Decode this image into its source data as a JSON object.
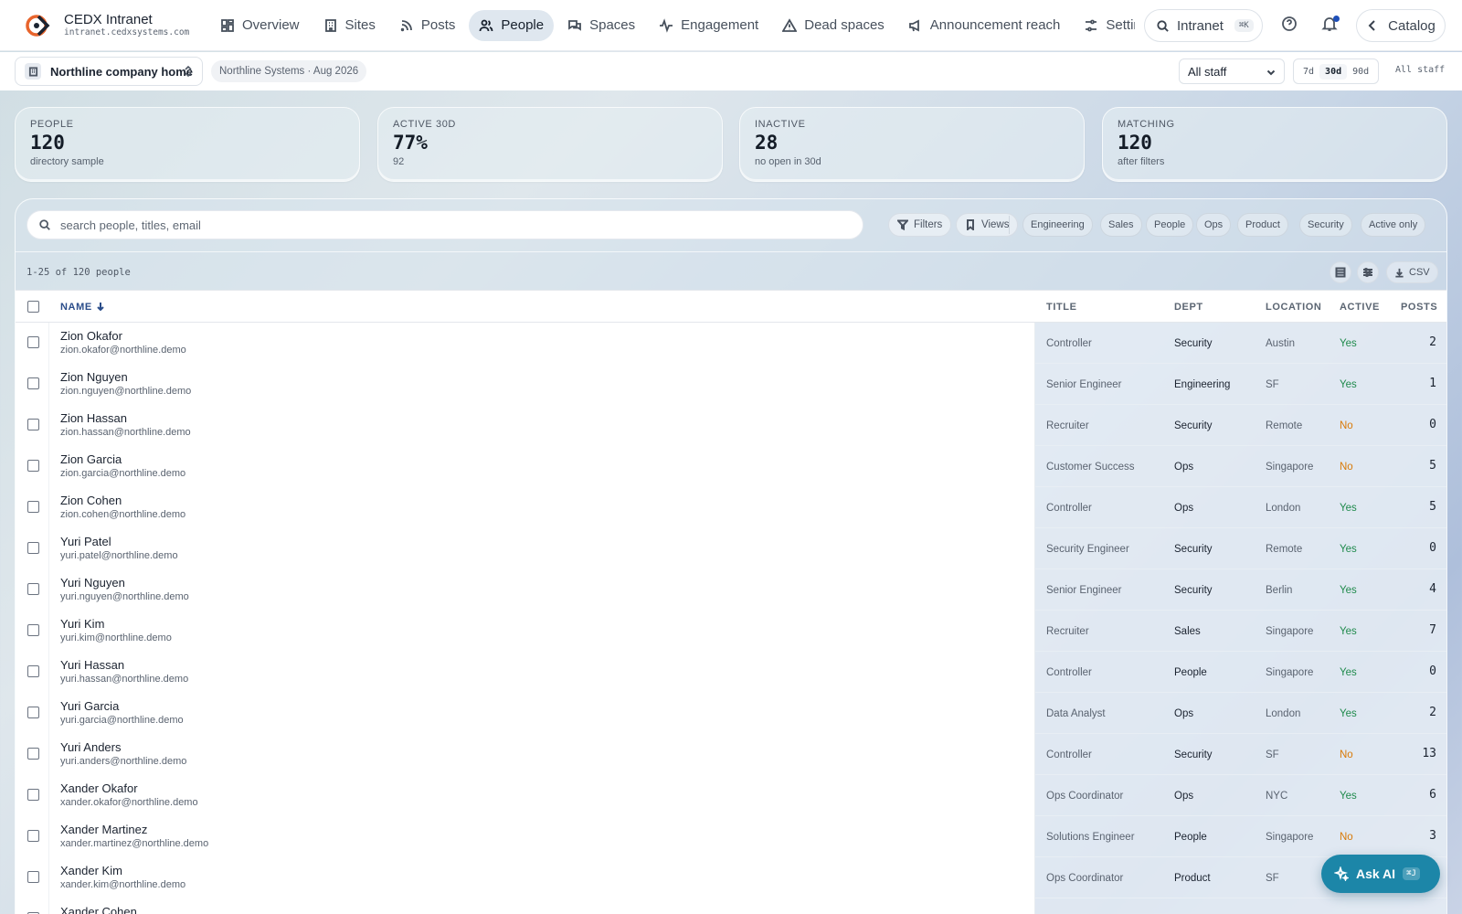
{
  "brand": {
    "name": "CEDX Intranet",
    "url": "intranet.cedxsystems.com"
  },
  "nav": [
    {
      "label": "Overview",
      "icon": "layout-grid-icon",
      "active": false
    },
    {
      "label": "Sites",
      "icon": "building-icon",
      "active": false
    },
    {
      "label": "Posts",
      "icon": "rss-icon",
      "active": false
    },
    {
      "label": "People",
      "icon": "users-icon",
      "active": true
    },
    {
      "label": "Spaces",
      "icon": "messages-icon",
      "active": false
    },
    {
      "label": "Engagement",
      "icon": "activity-icon",
      "active": false
    },
    {
      "label": "Dead spaces",
      "icon": "warning-triangle-icon",
      "active": false
    },
    {
      "label": "Announcement reach",
      "icon": "megaphone-icon",
      "active": false
    },
    {
      "label": "Settings",
      "icon": "sliders-icon",
      "active": false
    }
  ],
  "search": {
    "label": "Intranet",
    "shortcut": "⌘K"
  },
  "catalog_label": "Catalog",
  "subbar": {
    "site": "Northline company home",
    "org": "Northline Systems · Aug 2026",
    "staff_filter": "All staff",
    "ranges": [
      "7d",
      "30d",
      "90d"
    ],
    "active_range": "30d",
    "scope_label": "All staff"
  },
  "stats": [
    {
      "label": "PEOPLE",
      "value": "120",
      "sub": "directory sample"
    },
    {
      "label": "ACTIVE 30D",
      "value": "77%",
      "sub": "92"
    },
    {
      "label": "INACTIVE",
      "value": "28",
      "sub": "no open in 30d"
    },
    {
      "label": "MATCHING",
      "value": "120",
      "sub": "after filters"
    }
  ],
  "table_search_placeholder": "search people, titles, email",
  "filters_label": "Filters",
  "views_label": "Views",
  "chips": [
    "Engineering",
    "Sales",
    "People",
    "Ops",
    "Product",
    "Security",
    "Active only"
  ],
  "count_text": "1-25 of 120 people",
  "csv_label": "CSV",
  "columns": {
    "name": "NAME",
    "title": "TITLE",
    "dept": "DEPT",
    "location": "LOCATION",
    "active": "ACTIVE",
    "posts": "POSTS"
  },
  "rows": [
    {
      "name": "Zion Okafor",
      "email": "zion.okafor@northline.demo",
      "title": "Controller",
      "dept": "Security",
      "location": "Austin",
      "active": "Yes",
      "posts": "2"
    },
    {
      "name": "Zion Nguyen",
      "email": "zion.nguyen@northline.demo",
      "title": "Senior Engineer",
      "dept": "Engineering",
      "location": "SF",
      "active": "Yes",
      "posts": "1"
    },
    {
      "name": "Zion Hassan",
      "email": "zion.hassan@northline.demo",
      "title": "Recruiter",
      "dept": "Security",
      "location": "Remote",
      "active": "No",
      "posts": "0"
    },
    {
      "name": "Zion Garcia",
      "email": "zion.garcia@northline.demo",
      "title": "Customer Success",
      "dept": "Ops",
      "location": "Singapore",
      "active": "No",
      "posts": "5"
    },
    {
      "name": "Zion Cohen",
      "email": "zion.cohen@northline.demo",
      "title": "Controller",
      "dept": "Ops",
      "location": "London",
      "active": "Yes",
      "posts": "5"
    },
    {
      "name": "Yuri Patel",
      "email": "yuri.patel@northline.demo",
      "title": "Security Engineer",
      "dept": "Security",
      "location": "Remote",
      "active": "Yes",
      "posts": "0"
    },
    {
      "name": "Yuri Nguyen",
      "email": "yuri.nguyen@northline.demo",
      "title": "Senior Engineer",
      "dept": "Security",
      "location": "Berlin",
      "active": "Yes",
      "posts": "4"
    },
    {
      "name": "Yuri Kim",
      "email": "yuri.kim@northline.demo",
      "title": "Recruiter",
      "dept": "Sales",
      "location": "Singapore",
      "active": "Yes",
      "posts": "7"
    },
    {
      "name": "Yuri Hassan",
      "email": "yuri.hassan@northline.demo",
      "title": "Controller",
      "dept": "People",
      "location": "Singapore",
      "active": "Yes",
      "posts": "0"
    },
    {
      "name": "Yuri Garcia",
      "email": "yuri.garcia@northline.demo",
      "title": "Data Analyst",
      "dept": "Ops",
      "location": "London",
      "active": "Yes",
      "posts": "2"
    },
    {
      "name": "Yuri Anders",
      "email": "yuri.anders@northline.demo",
      "title": "Controller",
      "dept": "Security",
      "location": "SF",
      "active": "No",
      "posts": "13"
    },
    {
      "name": "Xander Okafor",
      "email": "xander.okafor@northline.demo",
      "title": "Ops Coordinator",
      "dept": "Ops",
      "location": "NYC",
      "active": "Yes",
      "posts": "6"
    },
    {
      "name": "Xander Martinez",
      "email": "xander.martinez@northline.demo",
      "title": "Solutions Engineer",
      "dept": "People",
      "location": "Singapore",
      "active": "No",
      "posts": "3"
    },
    {
      "name": "Xander Kim",
      "email": "xander.kim@northline.demo",
      "title": "Ops Coordinator",
      "dept": "Product",
      "location": "SF",
      "active": "",
      "posts": ""
    },
    {
      "name": "Xander Cohen",
      "email": "",
      "title": "",
      "dept": "",
      "location": "",
      "active": "",
      "posts": ""
    }
  ],
  "ask_ai": {
    "label": "Ask AI",
    "shortcut": "⌘J"
  }
}
